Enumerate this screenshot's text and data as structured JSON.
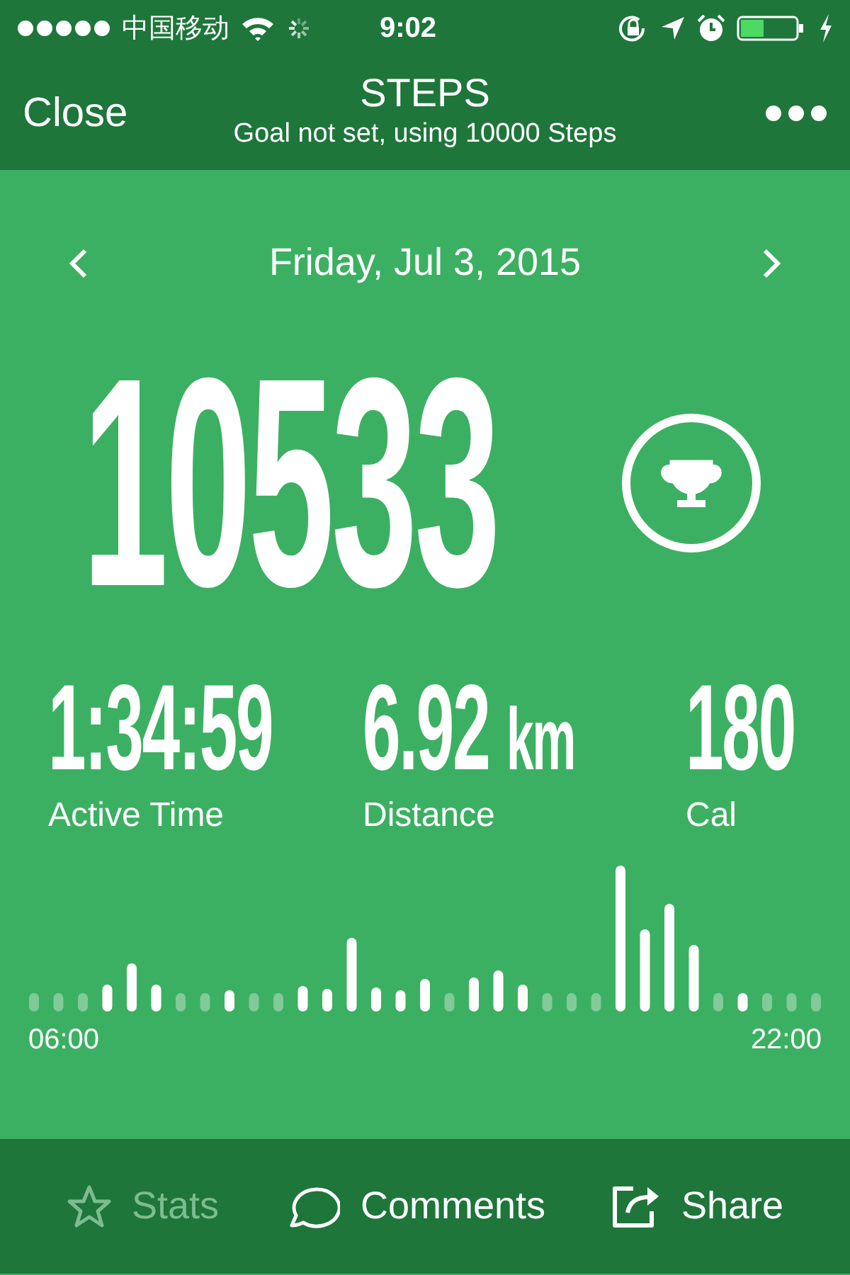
{
  "status_bar": {
    "carrier": "中国移动",
    "time": "9:02"
  },
  "nav": {
    "close": "Close",
    "title": "STEPS",
    "subtitle": "Goal not set, using 10000 Steps"
  },
  "date": "Friday, Jul 3, 2015",
  "steps": "10533",
  "metrics": [
    {
      "value": "1:34:59",
      "label": "Active Time"
    },
    {
      "value": "6.92",
      "unit": "km",
      "label": "Distance"
    },
    {
      "value": "180",
      "label": "Cal"
    }
  ],
  "chart": {
    "start_label": "06:00",
    "end_label": "22:00"
  },
  "toolbar": [
    {
      "kind": "star",
      "label": "Stats",
      "disabled": true
    },
    {
      "kind": "comment",
      "label": "Comments",
      "disabled": false
    },
    {
      "kind": "share",
      "label": "Share",
      "disabled": false
    }
  ]
}
